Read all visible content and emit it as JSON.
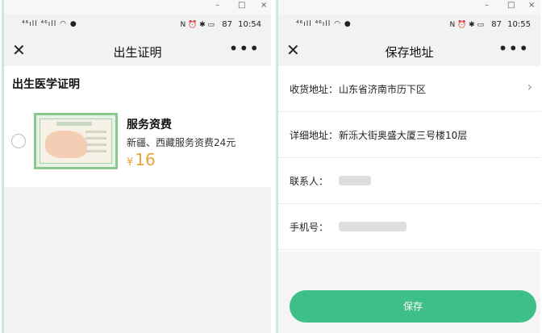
{
  "left_screen": {
    "window_controls": {
      "minimize": "–",
      "maximize": "□",
      "close": "×"
    },
    "status_bar": {
      "signal": "⁴⁶ıll ⁴⁶ıll ◠ ●",
      "icons": "N ⏰ ✱ ▭",
      "battery": "87",
      "time": "10:54"
    },
    "nav": {
      "close": "✕",
      "title": "出生证明",
      "more": "•••"
    },
    "section_title": "出生医学证明",
    "item": {
      "title": "服务资费",
      "description": "新疆、西藏服务资费24元",
      "currency": "¥",
      "price": "16"
    }
  },
  "right_screen": {
    "window_controls": {
      "minimize": "–",
      "maximize": "□",
      "close": "×"
    },
    "status_bar": {
      "signal": "⁴⁶ıll ⁴⁶ıll ◠ ●",
      "icons": "N ⏰ ✱ ▭",
      "battery": "87",
      "time": "10:55"
    },
    "nav": {
      "close": "✕",
      "title": "保存地址",
      "more": "•••"
    },
    "fields": [
      {
        "label": "收货地址：",
        "value": "山东省济南市历下区"
      },
      {
        "label": "详细地址：",
        "value": "新泺大街奥盛大厦三号楼10层"
      },
      {
        "label": "联系人：",
        "value": ""
      },
      {
        "label": "手机号：",
        "value": ""
      }
    ],
    "save_label": "保存"
  }
}
